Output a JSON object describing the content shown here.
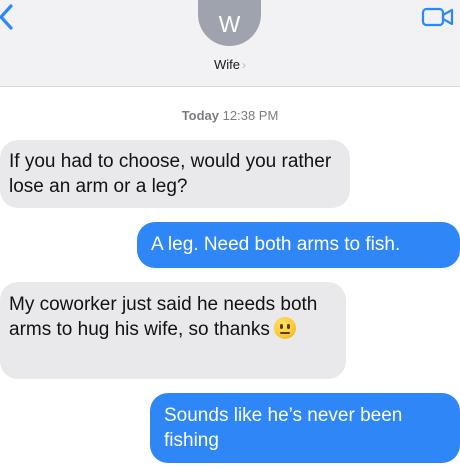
{
  "header": {
    "avatar_initial": "W",
    "contact_name": "Wife",
    "contact_chevron": "›",
    "icons": {
      "back": "chevron-left-icon",
      "video": "video-camera-icon"
    },
    "accent_color": "#2f86f6"
  },
  "conversation": {
    "timestamp_day": "Today",
    "timestamp_time": "12:38 PM",
    "messages": [
      {
        "direction": "incoming",
        "text": "If you had to choose, would you rather lose an arm or a leg?"
      },
      {
        "direction": "outgoing",
        "text": "A leg. Need both arms to fish."
      },
      {
        "direction": "incoming",
        "text": "My coworker just said he needs both arms to hug his wife, so thanks",
        "emoji": "neutral-face-emoji"
      },
      {
        "direction": "outgoing",
        "text": "Sounds like he’s never been fishing"
      }
    ]
  }
}
